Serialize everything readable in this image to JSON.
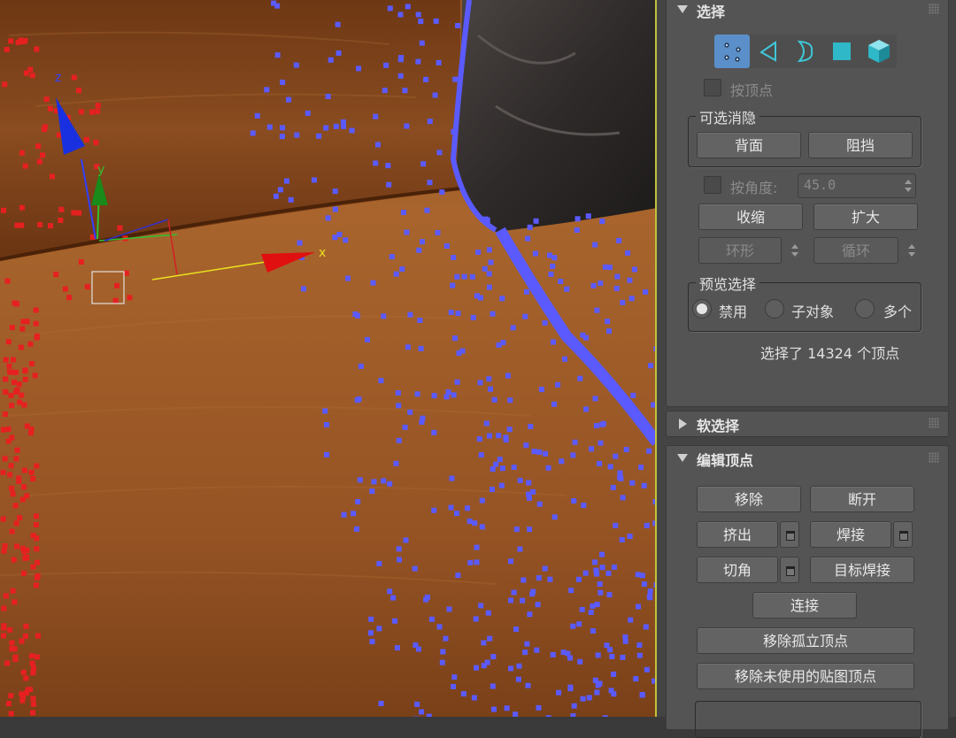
{
  "viewport": {
    "axis_z": "z",
    "axis_y": "y",
    "axis_x": "x"
  },
  "selection_rollout": {
    "title": "选择",
    "icons": [
      "vertex-icon",
      "edge-icon",
      "border-icon",
      "polygon-icon",
      "element-icon"
    ],
    "by_vertex": "按顶点",
    "culling_group": "可选消隐",
    "backface": "背面",
    "occluded": "阻挡",
    "by_angle": "按角度:",
    "angle_value": "45.0",
    "shrink": "收缩",
    "grow": "扩大",
    "ring": "环形",
    "loop": "循环",
    "preview_group": "预览选择",
    "preview_off": "禁用",
    "preview_subobject": "子对象",
    "preview_multi": "多个",
    "status": "选择了 14324 个顶点"
  },
  "soft_selection_rollout": {
    "title": "软选择"
  },
  "edit_vertices_rollout": {
    "title": "编辑顶点",
    "remove": "移除",
    "break": "断开",
    "extrude": "挤出",
    "weld": "焊接",
    "chamfer": "切角",
    "target_weld": "目标焊接",
    "connect": "连接",
    "remove_isolated": "移除孤立顶点",
    "remove_unused_map": "移除未使用的贴图顶点"
  },
  "colors": {
    "vertex_selected": "#5a5aff",
    "vertex_unselected": "#e62020",
    "axis_x": "#e01010",
    "axis_y": "#20a020",
    "axis_z": "#1830e0",
    "active_icon": "#5b8fc9"
  }
}
